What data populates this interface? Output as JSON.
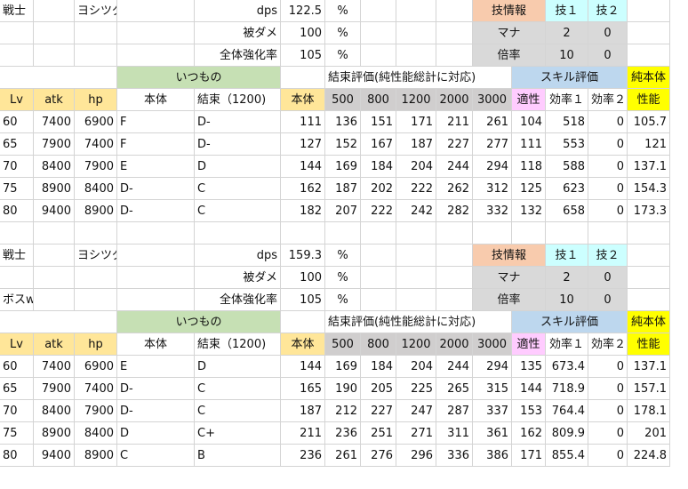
{
  "colors": {
    "salmon": "#f8cbad",
    "cyan": "#ccffff",
    "yellow": "#ffff00",
    "gray": "#d9d9d9",
    "darkgray": "#d0cece",
    "green": "#c6e0b4",
    "blue": "#bdd7ee",
    "orange": "#ffe699",
    "pink": "#ffccff",
    "white": "#ffffff",
    "grid": "#d4d4d4"
  },
  "sections": [
    {
      "info": [
        [
          "戦士",
          "",
          "ヨシツグ",
          "",
          "dps",
          "122.5",
          "%",
          "",
          "",
          "",
          "技情報",
          "技１",
          "技２"
        ],
        [
          "",
          "",
          "",
          "",
          "被ダメ",
          "100",
          "%",
          "",
          "",
          "",
          "マナ",
          "2",
          "0"
        ],
        [
          "",
          "",
          "",
          "",
          "全体強化率",
          "105",
          "%",
          "",
          "",
          "",
          "倍率",
          "10",
          "0"
        ]
      ],
      "group_header": {
        "itsumono": "いつもの",
        "kessoku_eval": "結束評価(純性能総計に対応)",
        "skill_eval": "スキル評価",
        "pure_body_1": "純本体"
      },
      "column_header": [
        "Lv",
        "atk",
        "hp",
        "本体",
        "結束（1200)",
        "本体",
        "500",
        "800",
        "1200",
        "2000",
        "3000",
        "適性",
        "効率１",
        "効率２",
        "性能"
      ],
      "rows": [
        [
          "60",
          "7400",
          "6900",
          "F",
          "D-",
          "111",
          "136",
          "151",
          "171",
          "211",
          "261",
          "104",
          "518",
          "0",
          "105.7"
        ],
        [
          "65",
          "7900",
          "7400",
          "F",
          "D-",
          "127",
          "152",
          "167",
          "187",
          "227",
          "277",
          "111",
          "553",
          "0",
          "121"
        ],
        [
          "70",
          "8400",
          "7900",
          "E",
          "D",
          "144",
          "169",
          "184",
          "204",
          "244",
          "294",
          "118",
          "588",
          "0",
          "137.1"
        ],
        [
          "75",
          "8900",
          "8400",
          "D-",
          "C",
          "162",
          "187",
          "202",
          "222",
          "262",
          "312",
          "125",
          "623",
          "0",
          "154.3"
        ],
        [
          "80",
          "9400",
          "8900",
          "D-",
          "C",
          "182",
          "207",
          "222",
          "242",
          "282",
          "332",
          "132",
          "658",
          "0",
          "173.3"
        ]
      ]
    },
    {
      "info": [
        [
          "戦士",
          "",
          "ヨシツグ",
          "",
          "dps",
          "159.3",
          "%",
          "",
          "",
          "",
          "技情報",
          "技１",
          "技２"
        ],
        [
          "",
          "",
          "",
          "",
          "被ダメ",
          "100",
          "%",
          "",
          "",
          "",
          "マナ",
          "2",
          "0"
        ],
        [
          "ボスwave",
          "",
          "",
          "",
          "全体強化率",
          "105",
          "%",
          "",
          "",
          "",
          "倍率",
          "10",
          "0"
        ]
      ],
      "group_header": {
        "itsumono": "いつもの",
        "kessoku_eval": "結束評価(純性能総計に対応)",
        "skill_eval": "スキル評価",
        "pure_body_1": "純本体"
      },
      "column_header": [
        "Lv",
        "atk",
        "hp",
        "本体",
        "結束（1200)",
        "本体",
        "500",
        "800",
        "1200",
        "2000",
        "3000",
        "適性",
        "効率１",
        "効率２",
        "性能"
      ],
      "rows": [
        [
          "60",
          "7400",
          "6900",
          "E",
          "D",
          "144",
          "169",
          "184",
          "204",
          "244",
          "294",
          "135",
          "673.4",
          "0",
          "137.1"
        ],
        [
          "65",
          "7900",
          "7400",
          "D-",
          "C",
          "165",
          "190",
          "205",
          "225",
          "265",
          "315",
          "144",
          "718.9",
          "0",
          "157.1"
        ],
        [
          "70",
          "8400",
          "7900",
          "D-",
          "C",
          "187",
          "212",
          "227",
          "247",
          "287",
          "337",
          "153",
          "764.4",
          "0",
          "178.1"
        ],
        [
          "75",
          "8900",
          "8400",
          "D",
          "C+",
          "211",
          "236",
          "251",
          "271",
          "311",
          "361",
          "162",
          "809.9",
          "0",
          "201"
        ],
        [
          "80",
          "9400",
          "8900",
          "C",
          "B",
          "236",
          "261",
          "276",
          "296",
          "336",
          "386",
          "171",
          "855.4",
          "0",
          "224.8"
        ]
      ]
    }
  ]
}
